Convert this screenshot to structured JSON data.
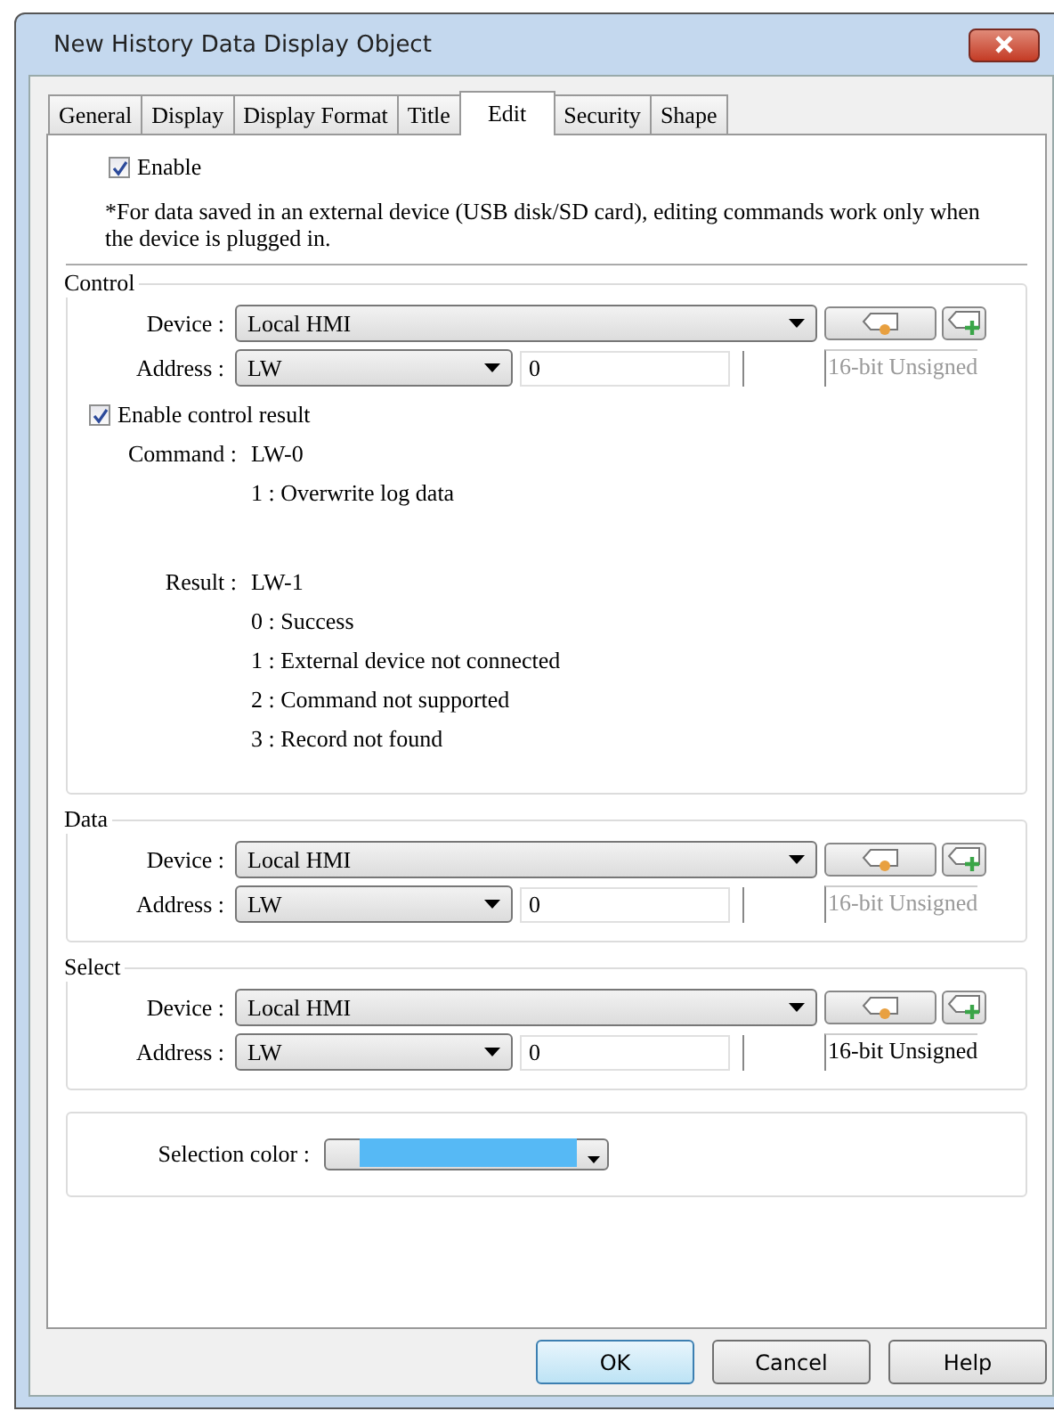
{
  "window": {
    "title": "New History Data Display Object"
  },
  "tabs": [
    {
      "label": "General",
      "selected": false
    },
    {
      "label": "Display",
      "selected": false
    },
    {
      "label": "Display Format",
      "selected": false
    },
    {
      "label": "Title",
      "selected": false
    },
    {
      "label": "Edit",
      "selected": true
    },
    {
      "label": "Security",
      "selected": false
    },
    {
      "label": "Shape",
      "selected": false
    }
  ],
  "enable": {
    "label": "Enable",
    "checked": true
  },
  "note": "*For data saved in an external device (USB disk/SD card), editing commands work only when the device is plugged in.",
  "groups": [
    {
      "title": "Control",
      "device_label": "Device :",
      "device": "Local HMI",
      "address_label": "Address :",
      "address_type": "LW",
      "address": "0",
      "data_type": "16-bit Unsigned",
      "data_type_disabled": true,
      "control_result": {
        "label": "Enable control result",
        "checked": true,
        "command_label": "Command :",
        "command": "LW-0",
        "command_values": [
          "1 : Overwrite log data"
        ],
        "result_label": "Result :",
        "result": "LW-1",
        "result_values": [
          "0 : Success",
          "1 : External device not connected",
          "2 : Command not supported",
          "3 : Record not found"
        ]
      }
    },
    {
      "title": "Data",
      "device_label": "Device :",
      "device": "Local HMI",
      "address_label": "Address :",
      "address_type": "LW",
      "address": "0",
      "data_type": "16-bit Unsigned",
      "data_type_disabled": true
    },
    {
      "title": "Select",
      "device_label": "Device :",
      "device": "Local HMI",
      "address_label": "Address :",
      "address_type": "LW",
      "address": "0",
      "data_type": "16-bit Unsigned",
      "data_type_disabled": false
    }
  ],
  "selection": {
    "label": "Selection color :",
    "color": "#56b9f5"
  },
  "buttons": [
    {
      "label": "OK",
      "default": true
    },
    {
      "label": "Cancel",
      "default": false
    },
    {
      "label": "Help",
      "default": false
    }
  ]
}
